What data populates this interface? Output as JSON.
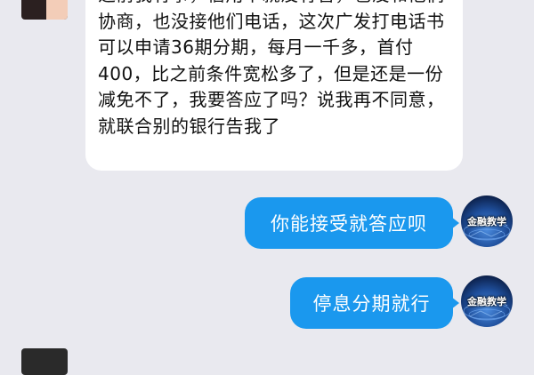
{
  "messages": [
    {
      "side": "left",
      "text": "之前我有事，信用卡就没有管，也没和他们协商，也没接他们电话，这次广发打电话书可以申请36期分期，每月一千多，首付400，比之前条件宽松多了，但是还是一份减免不了，我要答应了吗？说我再不同意，就联合别的银行告我了"
    },
    {
      "side": "right",
      "text": "你能接受就答应呗",
      "avatar_label": "金融教学"
    },
    {
      "side": "right",
      "text": "停息分期就行",
      "avatar_label": "金融教学"
    }
  ],
  "colors": {
    "background": "#e9e9ef",
    "incoming_bubble": "#ffffff",
    "outgoing_bubble": "#1a98ee",
    "outgoing_text": "#ffffff"
  },
  "icons": {
    "right_avatar": "globe-network-avatar"
  }
}
